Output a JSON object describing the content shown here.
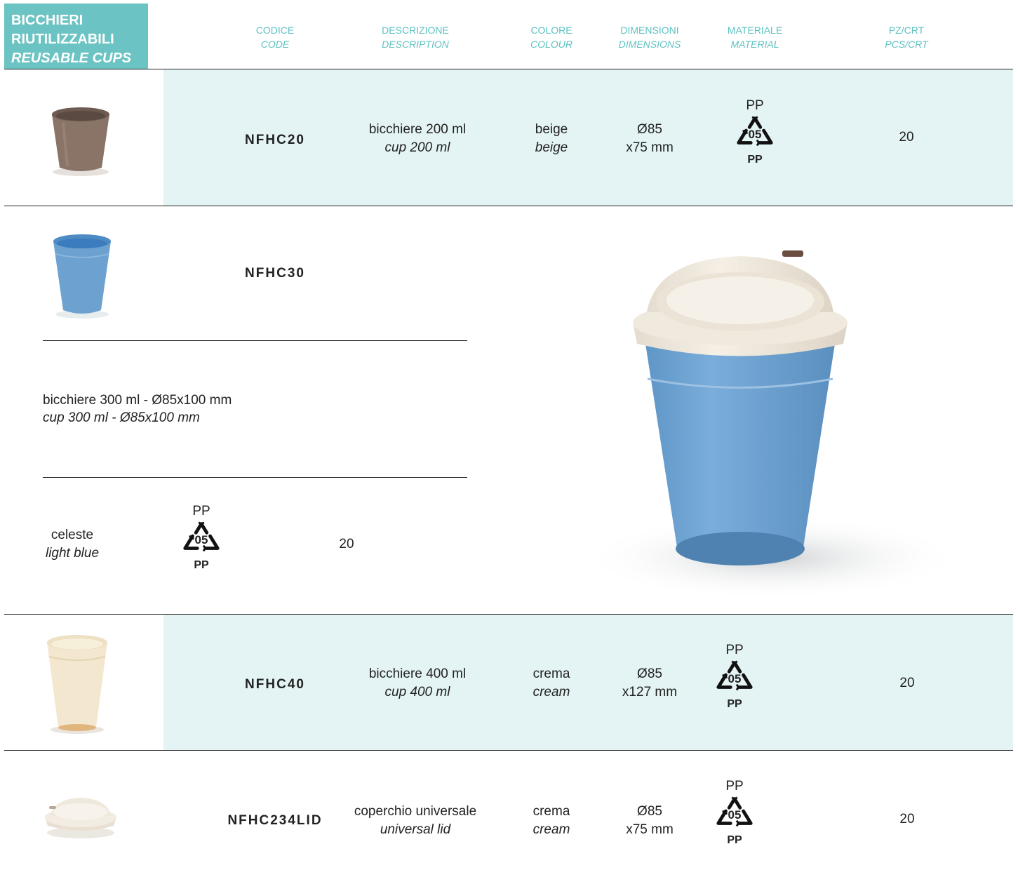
{
  "header": {
    "title_it_1": "BICCHIERI",
    "title_it_2": "RIUTILIZZABILI",
    "title_en": "REUSABLE CUPS",
    "columns": [
      {
        "it": "CODICE",
        "en": "CODE"
      },
      {
        "it": "DESCRIZIONE",
        "en": "DESCRIPTION"
      },
      {
        "it": "COLORE",
        "en": "COLOUR"
      },
      {
        "it": "DIMENSIONI",
        "en": "DIMENSIONS"
      },
      {
        "it": "MATERIALE",
        "en": "MATERIAL"
      },
      {
        "it": "PZ/CRT",
        "en": "PCS/CRT"
      }
    ]
  },
  "recycle": {
    "top": "PP",
    "code": "05",
    "bottom": "PP"
  },
  "rows": [
    {
      "code": "NFHC20",
      "desc_it": "bicchiere 200 ml",
      "desc_en": "cup 200 ml",
      "color_it": "beige",
      "color_en": "beige",
      "dim_1": "Ø85",
      "dim_2": "x75 mm",
      "pcs": "20"
    },
    {
      "code": "NFHC30",
      "desc_it": "bicchiere 300 ml - Ø85x100 mm",
      "desc_en": "cup 300 ml - Ø85x100 mm",
      "color_it": "celeste",
      "color_en": "light blue",
      "pcs": "20"
    },
    {
      "code": "NFHC40",
      "desc_it": "bicchiere 400 ml",
      "desc_en": "cup 400 ml",
      "color_it": "crema",
      "color_en": "cream",
      "dim_1": "Ø85",
      "dim_2": "x127 mm",
      "pcs": "20"
    },
    {
      "code": "NFHC234LID",
      "desc_it": "coperchio universale",
      "desc_en": "universal lid",
      "color_it": "crema",
      "color_en": "cream",
      "dim_1": "Ø85",
      "dim_2": "x75 mm",
      "pcs": "20"
    }
  ],
  "colors": {
    "accent": "#6cc3c3",
    "band": "#e4f4f4",
    "cup_brown": "#8a7468",
    "cup_blue": "#6da2d0",
    "cup_cream": "#f3e7cf",
    "lid_white": "#f2ece2"
  }
}
